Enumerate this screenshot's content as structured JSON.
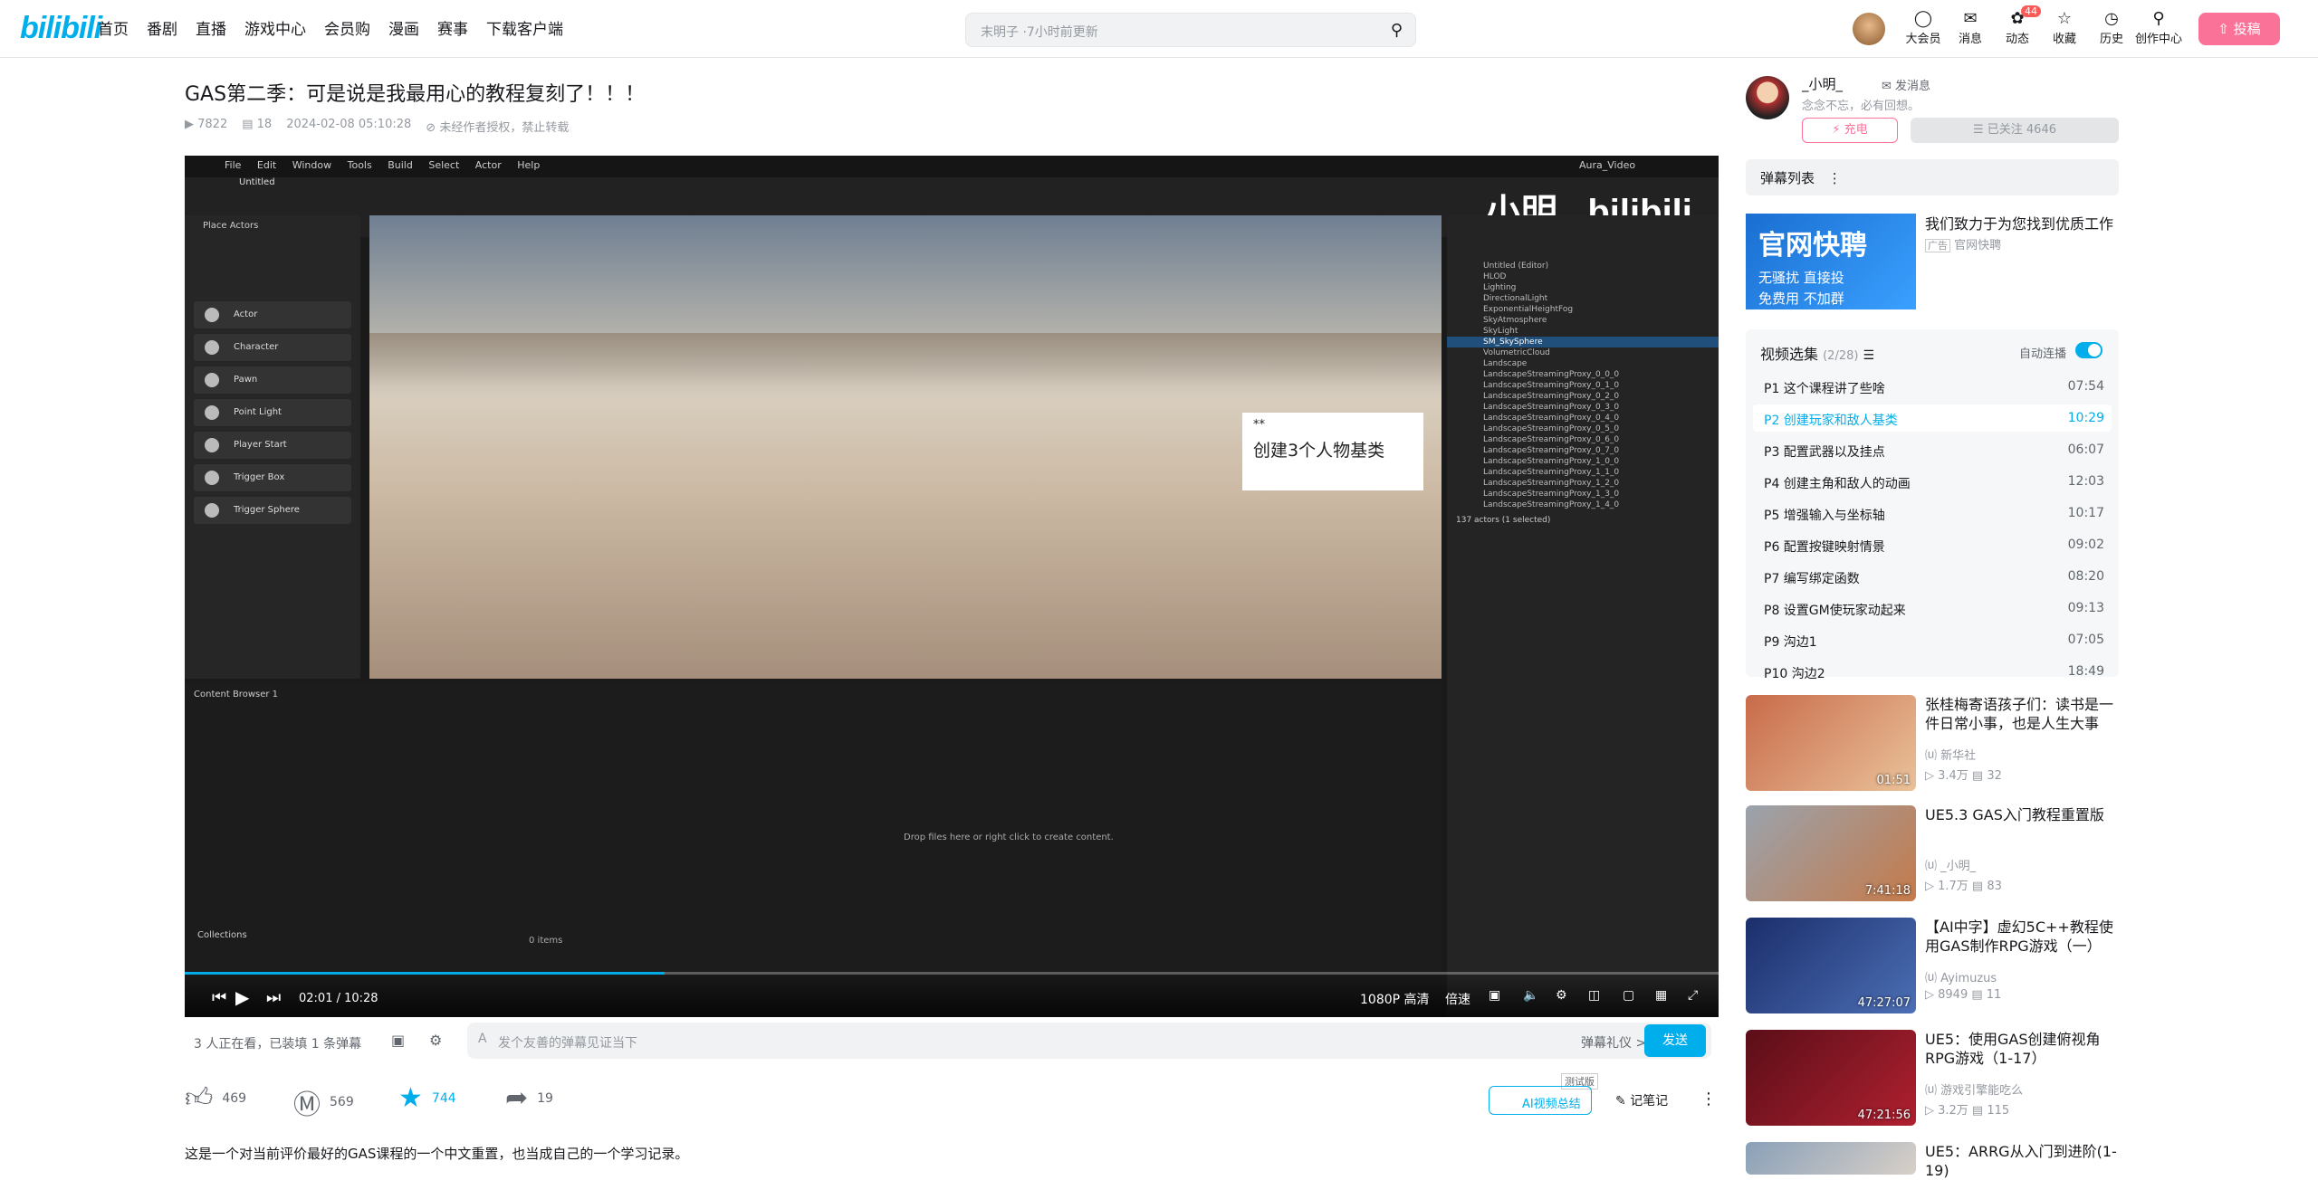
{
  "header": {
    "logo": "bilibili",
    "nav": [
      "首页",
      "番剧",
      "直播",
      "游戏中心",
      "会员购",
      "漫画",
      "赛事",
      "下载客户端"
    ],
    "search_placeholder": "末明子 ·7小时前更新",
    "right": [
      "大会员",
      "消息",
      "动态",
      "收藏",
      "历史",
      "创作中心"
    ],
    "dynamic_badge": "44",
    "upload": "投稿"
  },
  "video": {
    "title": "GAS第二季：可是说是我最用心的教程复刻了！！！",
    "views": "7822",
    "danmaku": "18",
    "date": "2024-02-08 05:10:28",
    "copyright": "未经作者授权，禁止转载"
  },
  "player": {
    "watermark": "小明_ bilibili",
    "callout_small": "**",
    "callout_big": "创建3个人物基类",
    "time": "02:01 / 10:28",
    "quality": "1080P 高清",
    "speed": "倍速",
    "ue_menu": [
      "File",
      "Edit",
      "Window",
      "Tools",
      "Build",
      "Select",
      "Actor",
      "Help"
    ],
    "ue_tab": "Untitled",
    "ue_window": "Aura_Video",
    "place_actors": "Place Actors",
    "actors": [
      "Actor",
      "Character",
      "Pawn",
      "Point Light",
      "Player Start",
      "Trigger Box",
      "Trigger Sphere"
    ],
    "outliner": [
      "Untitled (Editor)",
      "HLOD",
      "Lighting",
      "DirectionalLight",
      "ExponentialHeightFog",
      "SkyAtmosphere",
      "SkyLight",
      "SM_SkySphere",
      "VolumetricCloud",
      "Landscape",
      "LandscapeStreamingProxy_0_0_0",
      "LandscapeStreamingProxy_0_1_0",
      "LandscapeStreamingProxy_0_2_0",
      "LandscapeStreamingProxy_0_3_0",
      "LandscapeStreamingProxy_0_4_0",
      "LandscapeStreamingProxy_0_5_0",
      "LandscapeStreamingProxy_0_6_0",
      "LandscapeStreamingProxy_0_7_0",
      "LandscapeStreamingProxy_1_0_0",
      "LandscapeStreamingProxy_1_1_0",
      "LandscapeStreamingProxy_1_2_0",
      "LandscapeStreamingProxy_1_3_0",
      "LandscapeStreamingProxy_1_4_0"
    ],
    "actors_count": "137 actors (1 selected)",
    "content_browser": "Content Browser 1",
    "drop_hint": "Drop files here or right click to create content.",
    "collections": "Collections",
    "items": "0 items"
  },
  "danmu_bar": {
    "viewers": "3 人正在看，已装填 1 条弹幕",
    "placeholder": "发个友善的弹幕见证当下",
    "etiquette": "弹幕礼仪 >",
    "send": "发送"
  },
  "actions": {
    "like": "469",
    "coin": "569",
    "fav": "744",
    "share": "19",
    "ai_summary": "AI视频总结",
    "test": "测试版",
    "notes": "记笔记"
  },
  "description": "这是一个对当前评价最好的GAS课程的一个中文重置，也当成自己的一个学习记录。",
  "uploader": {
    "name": "_小明_",
    "message": "发消息",
    "sign": "念念不忘，必有回想。",
    "charge": "充电",
    "follow": "已关注 4646"
  },
  "danmaku_list": "弹幕列表",
  "ad": {
    "banner_line1": "官网快聘",
    "banner_line2": "无骚扰 直接投",
    "banner_line3": "免费用 不加群",
    "title": "我们致力于为您找到优质工作",
    "source": "官网快聘"
  },
  "playlist": {
    "title": "视频选集",
    "count": "(2/28)",
    "autoplay": "自动连播",
    "episodes": [
      {
        "p": "P1",
        "title": "这个课程讲了些啥",
        "dur": "07:54"
      },
      {
        "p": "P2",
        "title": "创建玩家和敌人基类",
        "dur": "10:29"
      },
      {
        "p": "P3",
        "title": "配置武器以及挂点",
        "dur": "06:07"
      },
      {
        "p": "P4",
        "title": "创建主角和敌人的动画",
        "dur": "12:03"
      },
      {
        "p": "P5",
        "title": "增强输入与坐标轴",
        "dur": "10:17"
      },
      {
        "p": "P6",
        "title": "配置按键映射情景",
        "dur": "09:02"
      },
      {
        "p": "P7",
        "title": "编写绑定函数",
        "dur": "08:20"
      },
      {
        "p": "P8",
        "title": "设置GM使玩家动起来",
        "dur": "09:13"
      },
      {
        "p": "P9",
        "title": "沟边1",
        "dur": "07:05"
      },
      {
        "p": "P10",
        "title": "沟边2",
        "dur": "18:49"
      }
    ]
  },
  "recommendations": [
    {
      "title": "张桂梅寄语孩子们：读书是一件日常小事，也是人生大事",
      "author": "新华社",
      "views": "3.4万",
      "danmaku": "32",
      "dur": "01:51"
    },
    {
      "title": "UE5.3 GAS入门教程重置版",
      "author": "_小明_",
      "views": "1.7万",
      "danmaku": "83",
      "dur": "7:41:18"
    },
    {
      "title": "【AI中字】虚幻5C++教程使用GAS制作RPG游戏（一）",
      "author": "Ayimuzus",
      "views": "8949",
      "danmaku": "11",
      "dur": "47:27:07"
    },
    {
      "title": "UE5：使用GAS创建俯视角RPG游戏（1-17）",
      "author": "游戏引擎能吃么",
      "views": "3.2万",
      "danmaku": "115",
      "dur": "47:21:56"
    },
    {
      "title": "UE5：ARRG从入门到进阶(1-19)",
      "author": "",
      "views": "",
      "danmaku": "",
      "dur": ""
    }
  ],
  "colors": {
    "accent": "#00aeec",
    "pink": "#fb7299"
  }
}
